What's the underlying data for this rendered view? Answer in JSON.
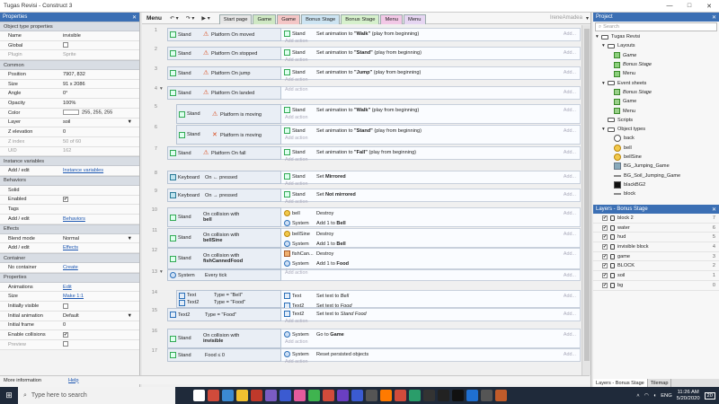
{
  "window": {
    "title": "Tugas Revisi - Construct 3",
    "controls": [
      "—",
      "□",
      "✕"
    ]
  },
  "properties": {
    "header": "Properties",
    "sections": [
      {
        "title": "Object type properties",
        "rows": [
          {
            "k": "Name",
            "v": "invisible"
          },
          {
            "k": "Global",
            "cb": ""
          },
          {
            "k": "Plugin",
            "v": "Sprite",
            "dim": true
          }
        ]
      },
      {
        "title": "Common",
        "rows": [
          {
            "k": "Position",
            "v": "7907, 832"
          },
          {
            "k": "Size",
            "v": "91 x 2086"
          },
          {
            "k": "Angle",
            "v": "0°"
          },
          {
            "k": "Opacity",
            "v": "100%"
          },
          {
            "k": "Color",
            "v": "255, 255, 255",
            "swatch": true
          },
          {
            "k": "Layer",
            "v": "soil",
            "dd": "▼"
          },
          {
            "k": "Z elevation",
            "v": "0"
          },
          {
            "k": "Z index",
            "v": "50 of 60",
            "dim": true
          },
          {
            "k": "UID",
            "v": "162",
            "dim": true
          }
        ]
      },
      {
        "title": "Instance variables",
        "rows": [
          {
            "k": "Add / edit",
            "v": "Instance variables",
            "link": true
          }
        ]
      },
      {
        "title": "Behaviors",
        "rows": [
          {
            "k": "Solid",
            "v": ""
          },
          {
            "k": "Enabled",
            "cb": "✔"
          },
          {
            "k": "Tags",
            "v": ""
          },
          {
            "k": "Add / edit",
            "v": "Behaviors",
            "link": true
          }
        ]
      },
      {
        "title": "Effects",
        "rows": [
          {
            "k": "Blend mode",
            "v": "Normal",
            "dd": "▼"
          },
          {
            "k": "Add / edit",
            "v": "Effects",
            "link": true
          }
        ]
      },
      {
        "title": "Container",
        "rows": [
          {
            "k": "No container",
            "v": "Create",
            "link": true
          }
        ]
      },
      {
        "title": "Properties",
        "rows": [
          {
            "k": "Animations",
            "v": "Edit",
            "link": true
          },
          {
            "k": "Size",
            "v": "Make 1:1",
            "link": true
          },
          {
            "k": "Initially visible",
            "cb": ""
          },
          {
            "k": "Initial animation",
            "v": "Default",
            "dd": "▼"
          },
          {
            "k": "Initial frame",
            "v": "0"
          },
          {
            "k": "Enable collisions",
            "cb": "✔"
          },
          {
            "k": "Preview",
            "cb": "",
            "dim": true
          }
        ]
      }
    ],
    "more_info": "More information",
    "help": "Help"
  },
  "toolbar": {
    "menu": "Menu",
    "undo": "↶ ▾",
    "redo": "↷ ▾",
    "play": "▶ ▾",
    "tabs": [
      {
        "label": "Start page",
        "color": "#e6e6e6"
      },
      {
        "label": "Game",
        "color": "#cfe8c4"
      },
      {
        "label": "Game",
        "color": "#f4c6c6"
      },
      {
        "label": "Bonus Stage",
        "color": "#cde4f2"
      },
      {
        "label": "Bonus Stage",
        "color": "#d6f0cc"
      },
      {
        "label": "Menu",
        "color": "#f2c8e6"
      },
      {
        "label": "Menu",
        "color": "#e6d6f2"
      }
    ],
    "user": "IreneAmadea"
  },
  "events": [
    {
      "num": "1",
      "conds": [
        {
          "obj": "Stand",
          "icon": "warn",
          "text": "Platform On moved"
        }
      ],
      "acts": [
        {
          "obj": "Stand",
          "pre": "Set animation to ",
          "bold": "\"Walk\"",
          "post": " (play from beginning)"
        }
      ]
    },
    {
      "num": "2",
      "conds": [
        {
          "obj": "Stand",
          "icon": "warn",
          "text": "Platform On stopped"
        }
      ],
      "acts": [
        {
          "obj": "Stand",
          "pre": "Set animation to ",
          "bold": "\"Stand\"",
          "post": " (play from beginning)"
        }
      ]
    },
    {
      "num": "3",
      "conds": [
        {
          "obj": "Stand",
          "icon": "warn",
          "text": "Platform On jump"
        }
      ],
      "acts": [
        {
          "obj": "Stand",
          "pre": "Set animation to ",
          "bold": "\"Jump\"",
          "post": " (play from beginning)"
        }
      ]
    },
    {
      "num": "4",
      "tog": "▾",
      "conds": [
        {
          "obj": "Stand",
          "icon": "warn",
          "text": "Platform On landed"
        }
      ],
      "acts": []
    },
    {
      "num": "5",
      "sub": true,
      "conds": [
        {
          "obj": "Stand",
          "icon": "warn",
          "text": "Platform is moving"
        }
      ],
      "acts": [
        {
          "obj": "Stand",
          "pre": "Set animation to ",
          "bold": "\"Walk\"",
          "post": " (play from beginning)"
        }
      ]
    },
    {
      "num": "6",
      "sub": true,
      "conds": [
        {
          "obj": "Stand",
          "icon": "x",
          "text": "Platform is moving"
        }
      ],
      "acts": [
        {
          "obj": "Stand",
          "pre": "Set animation to ",
          "bold": "\"Stand\"",
          "post": " (play from beginning)"
        }
      ]
    },
    {
      "num": "7",
      "conds": [
        {
          "obj": "Stand",
          "icon": "warn",
          "text": "Platform On fall"
        }
      ],
      "acts": [
        {
          "obj": "Stand",
          "pre": "Set animation to ",
          "bold": "\"Fall\"",
          "post": " (play from beginning)"
        }
      ]
    },
    {
      "num": "8",
      "conds": [
        {
          "obj": "Keyboard",
          "icon": "kb",
          "text": "On ← pressed"
        }
      ],
      "acts": [
        {
          "obj": "Stand",
          "pre": "Set ",
          "bold": "Mirrored",
          "post": ""
        }
      ]
    },
    {
      "num": "9",
      "conds": [
        {
          "obj": "Keyboard",
          "icon": "kb",
          "text": "On → pressed"
        }
      ],
      "acts": [
        {
          "obj": "Stand",
          "pre": "Set ",
          "bold": "Not mirrored",
          "post": ""
        }
      ]
    },
    {
      "num": "10",
      "conds": [
        {
          "obj": "Stand",
          "icon": "face",
          "text": "On collision with",
          "text2": "bell"
        }
      ],
      "acts": [
        {
          "obj": "bell",
          "oico": "face",
          "pre": "Destroy",
          "bold": "",
          "post": ""
        },
        {
          "obj": "System",
          "oico": "sys",
          "pre": "Add 1 to ",
          "bold": "Bell",
          "post": ""
        }
      ]
    },
    {
      "num": "11",
      "conds": [
        {
          "obj": "Stand",
          "icon": "face",
          "text": "On collision with",
          "text2": "bellSine"
        }
      ],
      "acts": [
        {
          "obj": "bellSine",
          "oico": "face",
          "pre": "Destroy",
          "bold": "",
          "post": ""
        },
        {
          "obj": "System",
          "oico": "sys",
          "pre": "Add 1 to ",
          "bold": "Bell",
          "post": ""
        }
      ]
    },
    {
      "num": "12",
      "conds": [
        {
          "obj": "Stand",
          "icon": "food",
          "text": "On collision with",
          "text2": "fishCannedFood"
        }
      ],
      "acts": [
        {
          "obj": "fishCan...",
          "oico": "food",
          "pre": "Destroy",
          "bold": "",
          "post": ""
        },
        {
          "obj": "System",
          "oico": "sys",
          "pre": "Add 1 to ",
          "bold": "Food",
          "post": ""
        }
      ]
    },
    {
      "num": "13",
      "tog": "▾",
      "conds": [
        {
          "obj": "System",
          "icon": "sys",
          "text": "Every tick"
        }
      ],
      "acts": []
    },
    {
      "num": "14",
      "sub": true,
      "conds": [
        {
          "obj": "Text",
          "icon": "txt",
          "text": "Type = \"Bell\""
        },
        {
          "obj": "Text2",
          "icon": "txt",
          "text": "Type = \"Food\""
        }
      ],
      "acts": [
        {
          "obj": "Text",
          "oico": "txt",
          "pre": "Set text to ",
          "bold": "",
          "post": "",
          "ital": "Bell"
        },
        {
          "obj": "Text2",
          "oico": "txt",
          "pre": "Set text to ",
          "bold": "",
          "post": "",
          "ital": "Food"
        }
      ]
    },
    {
      "num": "15",
      "conds": [
        {
          "obj": "Text2",
          "icon": "txt",
          "text": "Type = \"Food\""
        }
      ],
      "acts": [
        {
          "obj": "Text2",
          "oico": "txt",
          "pre": "Set text to ",
          "bold": "",
          "post": "",
          "ital": "Stand Food"
        }
      ]
    },
    {
      "num": "16",
      "conds": [
        {
          "obj": "Stand",
          "icon": "inv",
          "text": "On collision with",
          "text2": "invisible"
        }
      ],
      "acts": [
        {
          "obj": "System",
          "oico": "sys",
          "pre": "Go to ",
          "bold": "Game",
          "post": ""
        }
      ]
    },
    {
      "num": "17",
      "conds": [
        {
          "obj": "Stand",
          "icon": "",
          "text": "Food ≤ 0"
        }
      ],
      "acts": [
        {
          "obj": "System",
          "oico": "sys",
          "pre": "Reset persisted objects",
          "bold": "",
          "post": ""
        }
      ]
    }
  ],
  "add_action": "Add action",
  "add_side": "Add...",
  "project": {
    "header": "Project",
    "search": "Search",
    "items": [
      {
        "label": "Tugas Revisi",
        "type": "fold",
        "indent": 0,
        "tog": "▾"
      },
      {
        "label": "Layouts",
        "type": "fold",
        "indent": 1,
        "tog": "▾"
      },
      {
        "label": "Game",
        "type": "lay",
        "indent": 2,
        "ital": true
      },
      {
        "label": "Bonus Stage",
        "type": "lay",
        "indent": 2,
        "ital": true
      },
      {
        "label": "Menu",
        "type": "lay",
        "indent": 2
      },
      {
        "label": "Event sheets",
        "type": "fold",
        "indent": 1,
        "tog": "▾"
      },
      {
        "label": "Bonus Stage",
        "type": "ev",
        "indent": 2,
        "ital": true
      },
      {
        "label": "Game",
        "type": "ev",
        "indent": 2
      },
      {
        "label": "Menu",
        "type": "ev",
        "indent": 2
      },
      {
        "label": "Scripts",
        "type": "fold",
        "indent": 1
      },
      {
        "label": "Object types",
        "type": "fold",
        "indent": 1,
        "tog": "▾"
      },
      {
        "label": "back",
        "type": "ot",
        "indent": 2
      },
      {
        "label": "bell",
        "type": "otf",
        "indent": 2
      },
      {
        "label": "bellSine",
        "type": "otf",
        "indent": 2
      },
      {
        "label": "BG_Jumping_Game",
        "type": "otbg",
        "indent": 2
      },
      {
        "label": "BG_Soil_Jumping_Game",
        "type": "otline",
        "indent": 2
      },
      {
        "label": "blackBG2",
        "type": "otsq",
        "indent": 2
      },
      {
        "label": "block",
        "type": "otline",
        "indent": 2
      }
    ]
  },
  "layers": {
    "header": "Layers - Bonus Stage",
    "items": [
      {
        "name": "block 2",
        "num": "7"
      },
      {
        "name": "water",
        "num": "6"
      },
      {
        "name": "hud",
        "num": "5"
      },
      {
        "name": "invisible block",
        "num": "4"
      },
      {
        "name": "game",
        "num": "3"
      },
      {
        "name": "BLOCK",
        "num": "2"
      },
      {
        "name": "soil",
        "num": "1"
      },
      {
        "name": "bg",
        "num": "0"
      }
    ],
    "tabs": [
      "Layers - Bonus Stage",
      "Tilemap"
    ]
  },
  "taskbar": {
    "search": "Type here to search",
    "lang": "ENG",
    "time": "11:26 AM",
    "date": "5/20/2020",
    "badge": "20",
    "apps": [
      "#ffffff",
      "#d14b3b",
      "#3b8ad1",
      "#f0c030",
      "#c0392b",
      "#7a5cc2",
      "#3b5bd1",
      "#e55b9c",
      "#3fb44f",
      "#d14b3b",
      "#6a3fc2",
      "#3b5bd1",
      "#555555",
      "#ff7a00",
      "#d14b3b",
      "#2a9d6a",
      "#333333",
      "#222222",
      "#111111",
      "#1f6fd1",
      "#555555",
      "#c05b2a"
    ]
  }
}
